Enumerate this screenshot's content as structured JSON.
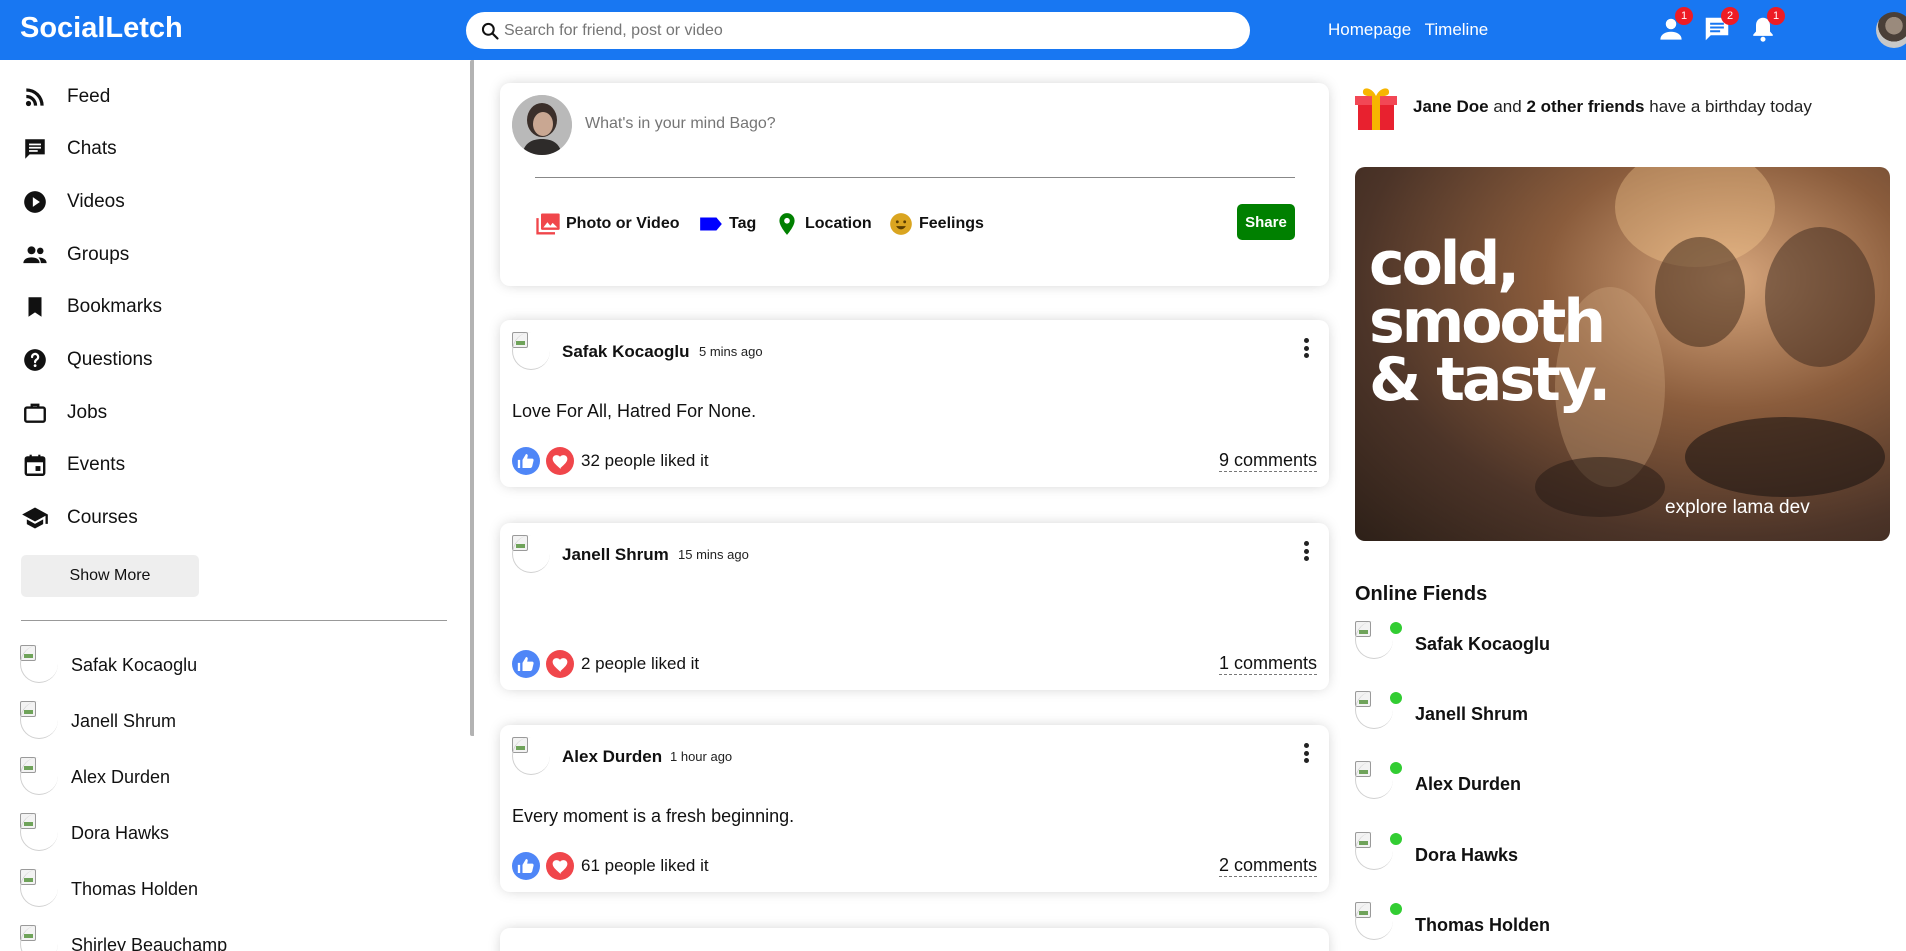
{
  "topbar": {
    "logo": "SocialLetch",
    "search_placeholder": "Search for friend, post or video",
    "links": [
      "Homepage",
      "Timeline"
    ],
    "badges": {
      "friends": "1",
      "messages": "2",
      "notifications": "1"
    }
  },
  "sidebar": {
    "menu": [
      {
        "label": "Feed",
        "icon": "rss-feed-icon"
      },
      {
        "label": "Chats",
        "icon": "chat-icon"
      },
      {
        "label": "Videos",
        "icon": "play-circle-icon"
      },
      {
        "label": "Groups",
        "icon": "group-icon"
      },
      {
        "label": "Bookmarks",
        "icon": "bookmark-icon"
      },
      {
        "label": "Questions",
        "icon": "help-circle-icon"
      },
      {
        "label": "Jobs",
        "icon": "briefcase-icon"
      },
      {
        "label": "Events",
        "icon": "calendar-icon"
      },
      {
        "label": "Courses",
        "icon": "school-icon"
      }
    ],
    "show_more": "Show More",
    "friends": [
      "Safak Kocaoglu",
      "Janell Shrum",
      "Alex Durden",
      "Dora Hawks",
      "Thomas Holden",
      "Shirley Beauchamp"
    ]
  },
  "share": {
    "placeholder": "What's in your mind Bago?",
    "options": [
      {
        "label": "Photo or Video",
        "icon": "photo-library-icon",
        "color": "#f0464b"
      },
      {
        "label": "Tag",
        "icon": "label-icon",
        "color": "#0000ff"
      },
      {
        "label": "Location",
        "icon": "location-pin-icon",
        "color": "#008000"
      },
      {
        "label": "Feelings",
        "icon": "emoji-icon",
        "color": "#daa520"
      }
    ],
    "button": "Share",
    "button_color": "#008000"
  },
  "posts": [
    {
      "user": "Safak Kocaoglu",
      "time": "5 mins ago",
      "text": "Love For All, Hatred For None.",
      "likes": "32 people liked it",
      "comments": "9 comments"
    },
    {
      "user": "Janell Shrum",
      "time": "15 mins ago",
      "text": "",
      "likes": "2 people liked it",
      "comments": "1 comments"
    },
    {
      "user": "Alex Durden",
      "time": "1 hour ago",
      "text": "Every moment is a fresh beginning.",
      "likes": "61 people liked it",
      "comments": "2 comments"
    }
  ],
  "rightbar": {
    "birthday": {
      "name": "Jane Doe",
      "joiner": "and",
      "others": "2 other friends",
      "suffix": "have a birthday today"
    },
    "ad": {
      "line1": "cold,",
      "line2": "smooth",
      "line3": "& tasty.",
      "footer": "explore lama dev"
    },
    "online_title": "Online Fiends",
    "online": [
      "Safak Kocaoglu",
      "Janell Shrum",
      "Alex Durden",
      "Dora Hawks",
      "Thomas Holden"
    ]
  },
  "colors": {
    "brand": "#1877f2",
    "online": "#32cd32",
    "badge": "#ee1c24",
    "like": "#4f86f7",
    "heart": "#f0464b"
  }
}
